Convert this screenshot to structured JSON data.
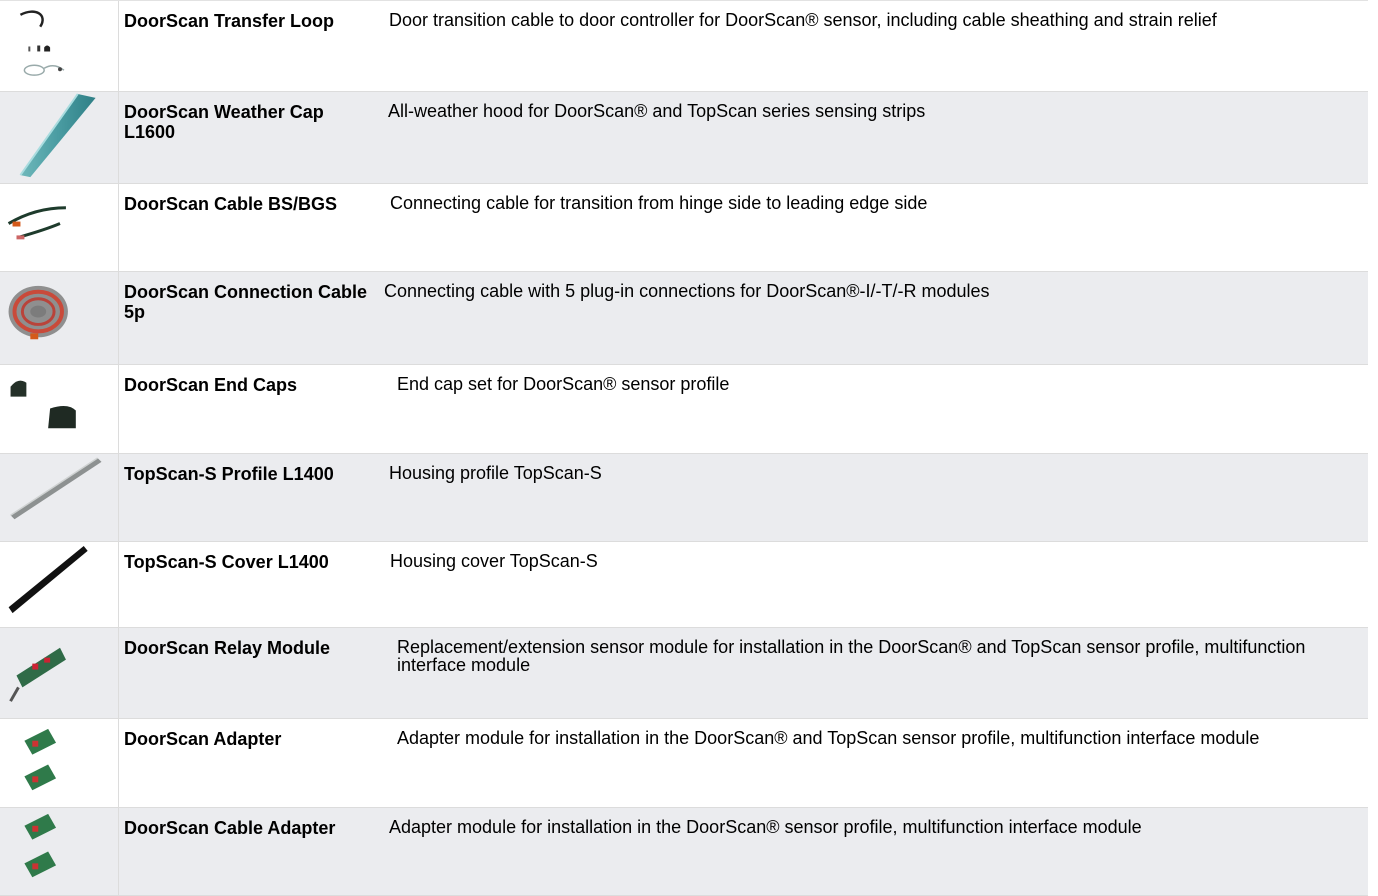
{
  "rows": [
    {
      "name": "DoorScan Transfer Loop",
      "desc": "Door transition cable to door controller for DoorScan® sensor, including cable sheathing and strain relief",
      "image": "transfer-loop-cable-photo"
    },
    {
      "name": "DoorScan Weather Cap L1600",
      "desc": "All-weather hood for DoorScan® and TopScan series sensing strips",
      "image": "weather-cap-photo"
    },
    {
      "name": "DoorScan Cable BS/BGS",
      "desc": "Connecting cable for transition from hinge side to leading edge side",
      "image": "cable-bs-bgs-photo"
    },
    {
      "name": "DoorScan Connection Cable 5p",
      "desc": "Connecting cable with 5 plug-in connections for DoorScan®-I/-T/-R modules",
      "image": "connection-cable-coil-photo"
    },
    {
      "name": "DoorScan End Caps",
      "desc": "End cap set for DoorScan® sensor profile",
      "image": "end-caps-photo"
    },
    {
      "name": "TopScan-S Profile L1400",
      "desc": "Housing profile TopScan-S",
      "image": "profile-rail-photo"
    },
    {
      "name": "TopScan-S Cover L1400",
      "desc": "Housing cover TopScan-S",
      "image": "cover-rail-photo"
    },
    {
      "name": "DoorScan Relay Module",
      "desc": "Replacement/extension sensor module for installation in the DoorScan® and TopScan sensor profile, multifunction interface module",
      "image": "relay-module-photo"
    },
    {
      "name": "DoorScan Adapter",
      "desc": "Adapter module for installation in the DoorScan® and TopScan sensor profile, multifunction interface module",
      "image": "adapter-module-photo"
    },
    {
      "name": "DoorScan Cable Adapter",
      "desc": "Adapter module for installation in the DoorScan® sensor profile, multifunction interface module",
      "image": "cable-adapter-module-photo"
    }
  ]
}
